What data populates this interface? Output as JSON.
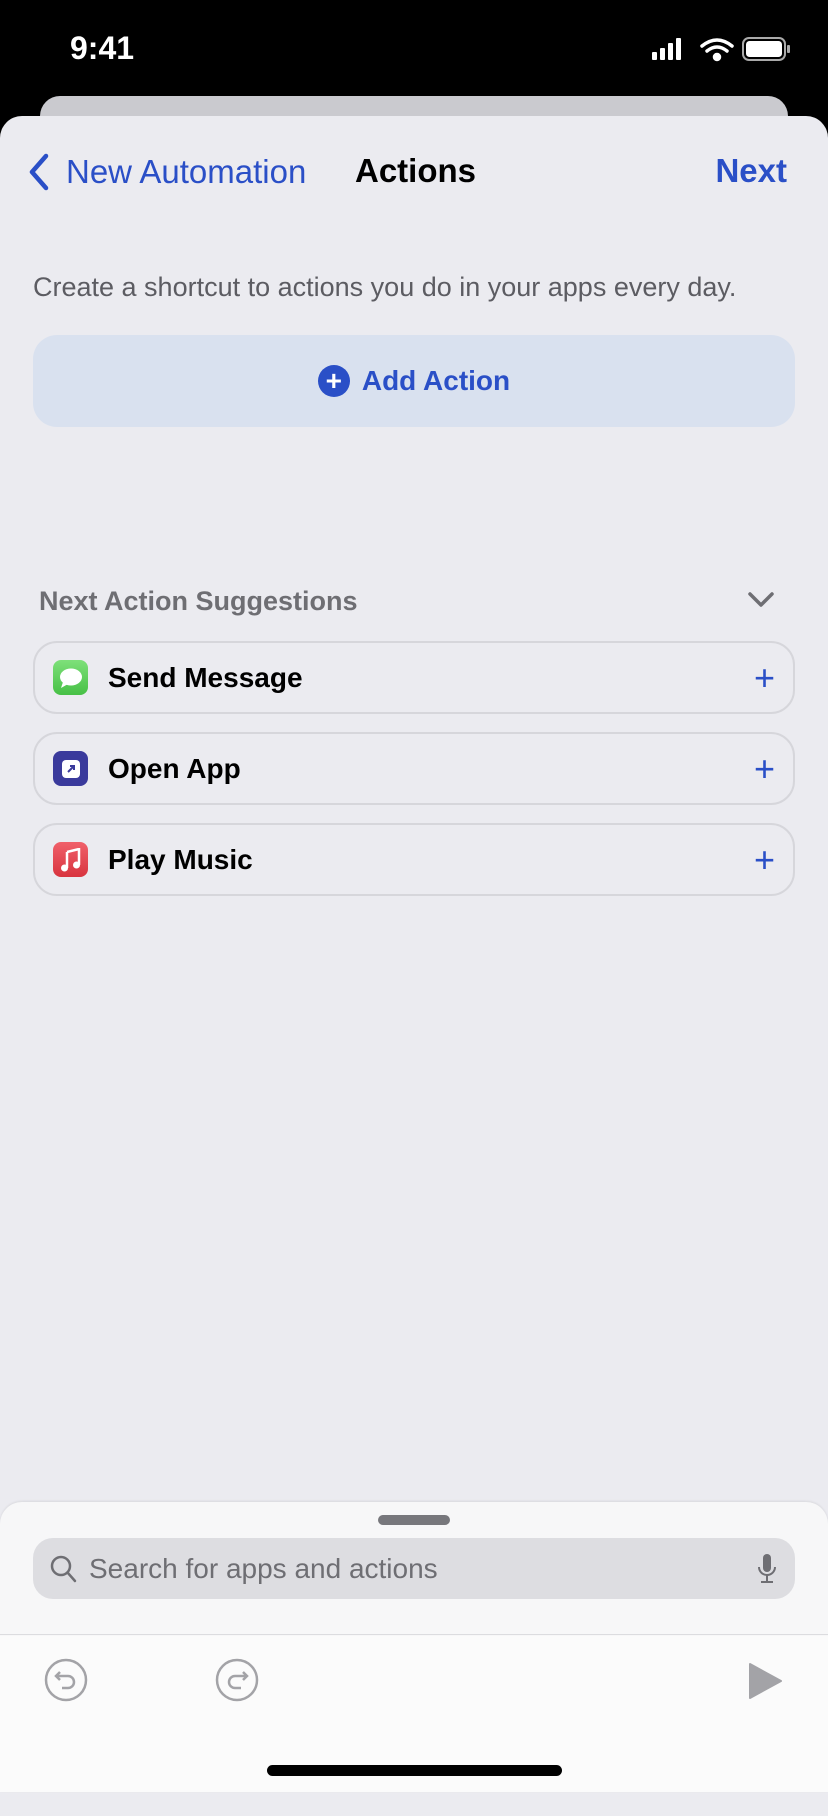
{
  "status_bar": {
    "time": "9:41"
  },
  "nav": {
    "back_label": "New Automation",
    "title": "Actions",
    "next_label": "Next"
  },
  "subtitle": "Create a shortcut to actions you do in your apps every day.",
  "add_action": {
    "label": "Add Action"
  },
  "suggestions": {
    "header": "Next Action Suggestions",
    "items": [
      {
        "label": "Send Message",
        "icon": "messages-icon",
        "color": "#5fcf5a"
      },
      {
        "label": "Open App",
        "icon": "open-app-icon",
        "color": "#3a3a9c"
      },
      {
        "label": "Play Music",
        "icon": "music-icon",
        "color": "#e3444f"
      }
    ]
  },
  "search": {
    "placeholder": "Search for apps and actions"
  },
  "colors": {
    "accent": "#2a4fc7"
  }
}
